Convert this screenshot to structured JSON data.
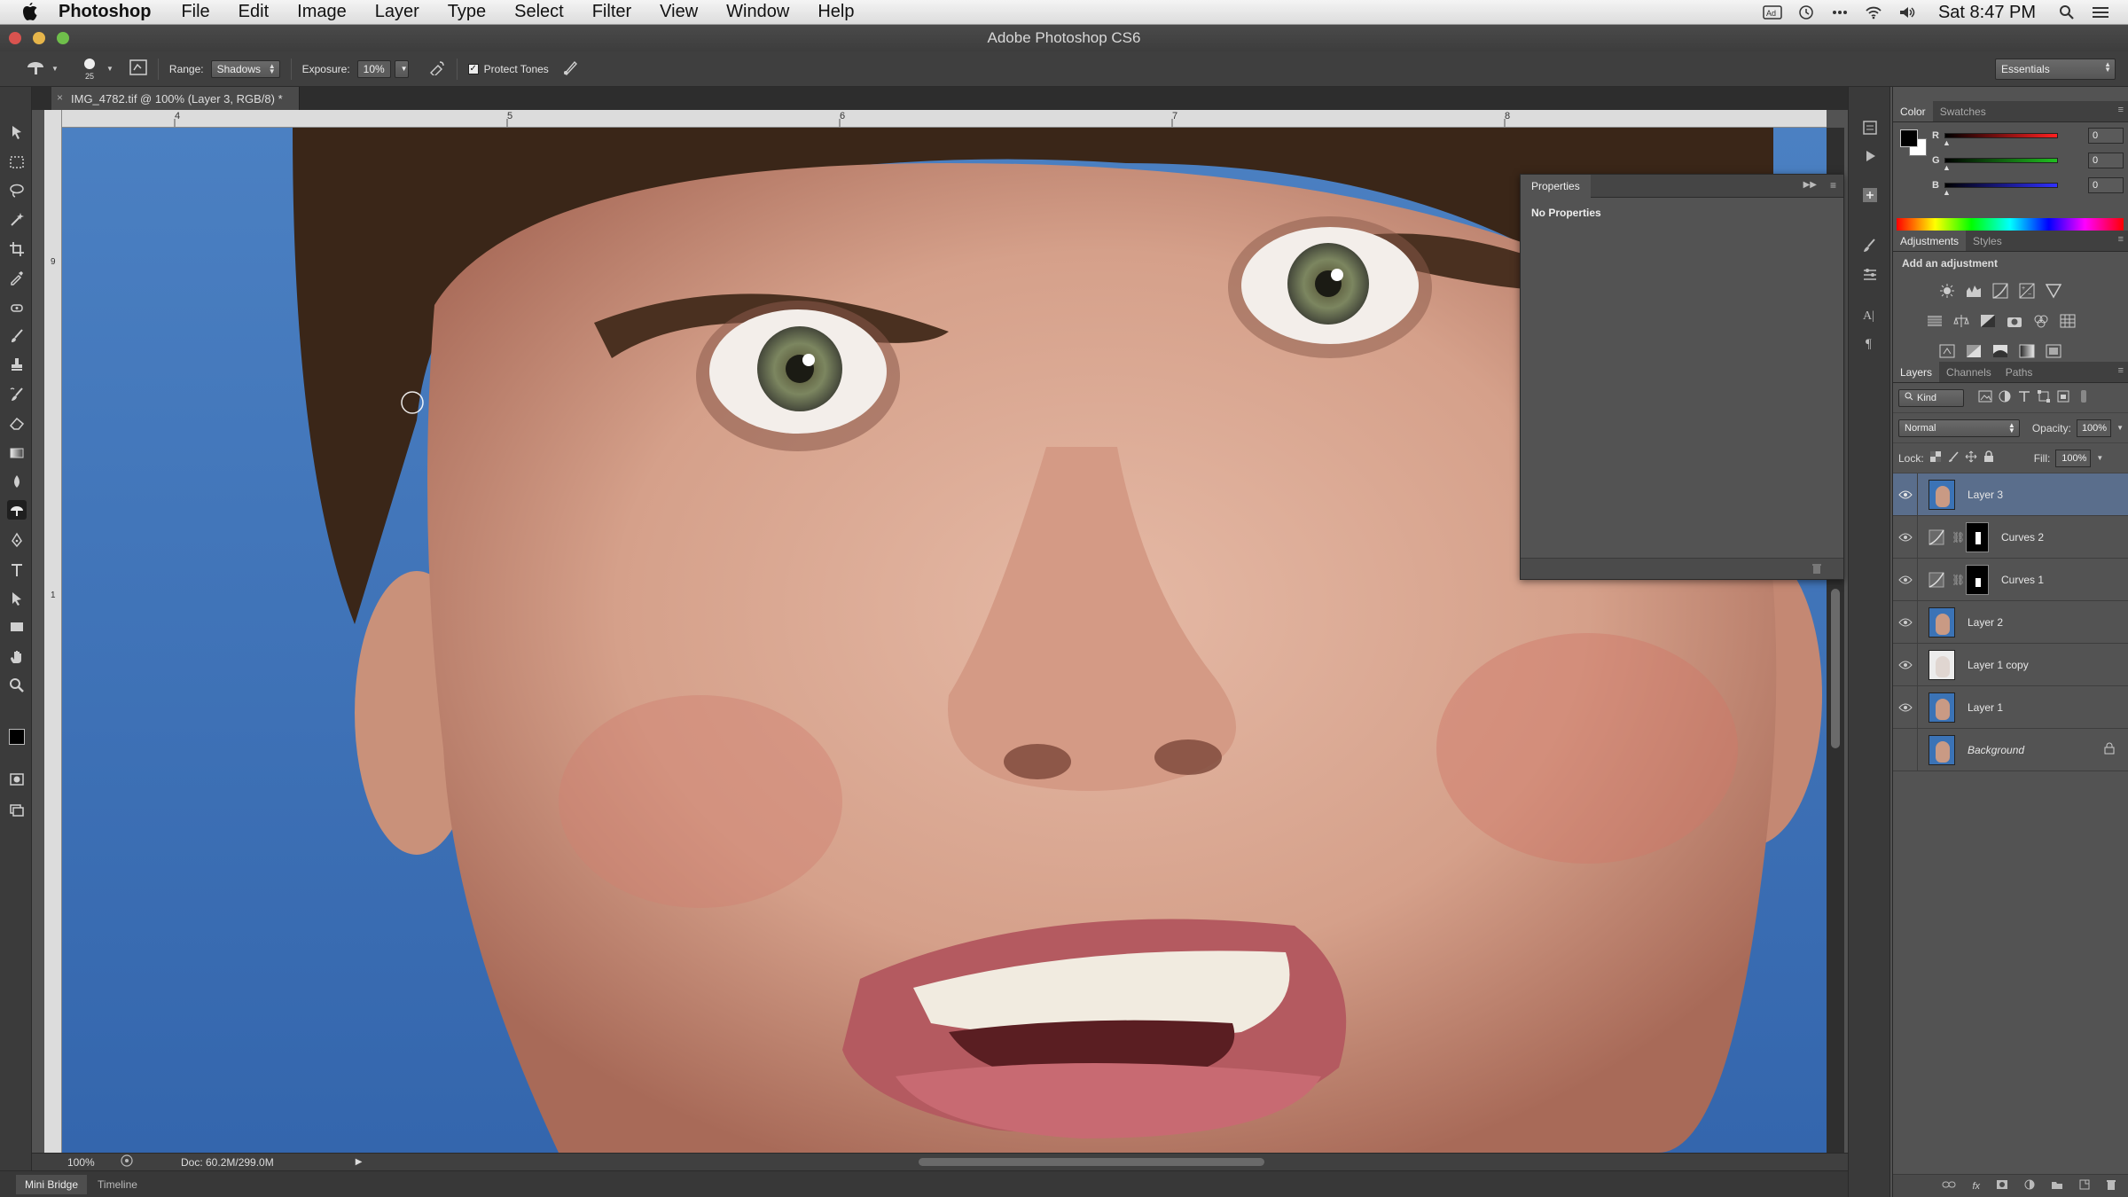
{
  "menubar": {
    "app_name": "Photoshop",
    "items": [
      "File",
      "Edit",
      "Image",
      "Layer",
      "Type",
      "Select",
      "Filter",
      "View",
      "Window",
      "Help"
    ],
    "clock": "Sat 8:47 PM",
    "status_icons": [
      "adobe-badge-icon",
      "time-machine-icon",
      "more-icon",
      "wifi-icon",
      "volume-icon",
      "spotlight-icon",
      "notification-list-icon"
    ]
  },
  "titlebar": {
    "title": "Adobe Photoshop CS6"
  },
  "options": {
    "brush_size": "25",
    "range_label": "Range:",
    "range_value": "Shadows",
    "exposure_label": "Exposure:",
    "exposure_value": "10%",
    "protect_tones_label": "Protect Tones",
    "protect_tones_checked": true,
    "workspace": "Essentials"
  },
  "document": {
    "tab_title": "IMG_4782.tif @ 100% (Layer 3, RGB/8) *",
    "ruler_h_labels": [
      "4",
      "5",
      "6",
      "7",
      "8"
    ],
    "ruler_v_labels": [
      "9",
      "1"
    ],
    "zoom": "100%",
    "doc_info": "Doc: 60.2M/299.0M"
  },
  "bottom_tabs": [
    "Mini Bridge",
    "Timeline"
  ],
  "properties": {
    "tab": "Properties",
    "body": "No Properties"
  },
  "color_panel": {
    "tabs": [
      "Color",
      "Swatches"
    ],
    "channels": [
      {
        "label": "R",
        "value": "0",
        "gradient_end": "#ff2020"
      },
      {
        "label": "G",
        "value": "0",
        "gradient_end": "#20c020"
      },
      {
        "label": "B",
        "value": "0",
        "gradient_end": "#3030ff"
      }
    ]
  },
  "adjustments_panel": {
    "tabs": [
      "Adjustments",
      "Styles"
    ],
    "add_label": "Add an adjustment"
  },
  "layers_panel": {
    "tabs": [
      "Layers",
      "Channels",
      "Paths"
    ],
    "kind_label": "Kind",
    "blend_mode": "Normal",
    "opacity_label": "Opacity:",
    "opacity_value": "100%",
    "lock_label": "Lock:",
    "fill_label": "Fill:",
    "fill_value": "100%",
    "layers": [
      {
        "name": "Layer 3",
        "kind": "pixel",
        "visible": true,
        "selected": true
      },
      {
        "name": "Curves 2",
        "kind": "curves",
        "visible": true,
        "selected": false
      },
      {
        "name": "Curves 1",
        "kind": "curves",
        "visible": true,
        "selected": false
      },
      {
        "name": "Layer 2",
        "kind": "pixel",
        "visible": true,
        "selected": false
      },
      {
        "name": "Layer 1 copy",
        "kind": "pixel-white",
        "visible": true,
        "selected": false
      },
      {
        "name": "Layer 1",
        "kind": "pixel",
        "visible": true,
        "selected": false
      },
      {
        "name": "Background",
        "kind": "pixel",
        "visible": false,
        "selected": false,
        "locked": true
      }
    ],
    "footer_icons": [
      "link-layers-icon",
      "fx-icon",
      "add-mask-icon",
      "new-adjustment-icon",
      "new-group-icon",
      "new-layer-icon",
      "trash-icon"
    ]
  },
  "colors": {
    "canvas_bg": "#3b73b6",
    "selected_layer": "#5a6e8c",
    "panel_bg": "#535353"
  }
}
